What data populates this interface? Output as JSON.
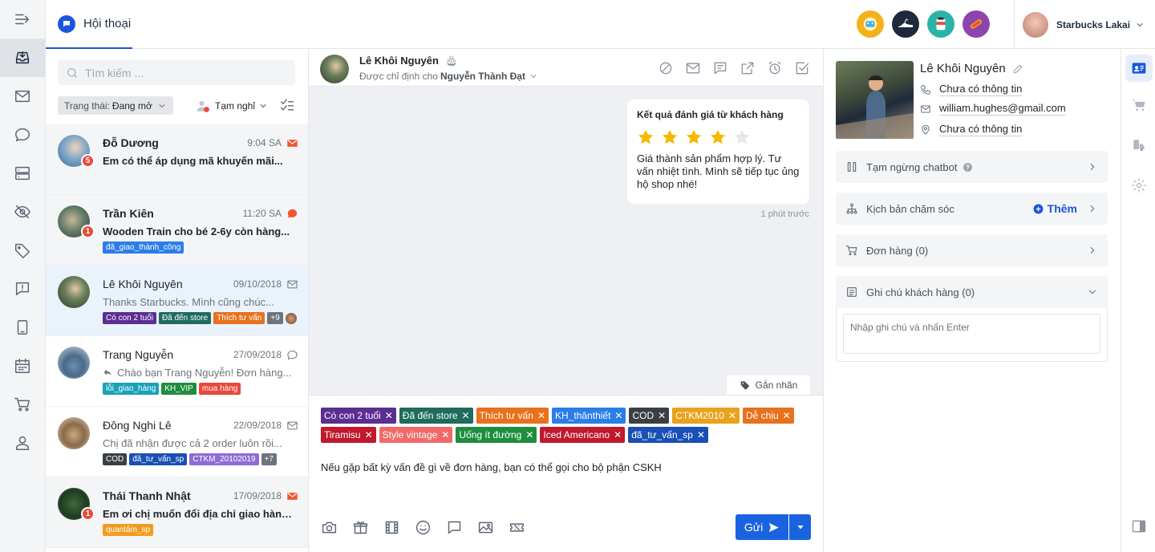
{
  "header": {
    "tab_title": "Hội thoại",
    "account_name": "Starbucks Lakai",
    "pages": [
      {
        "icon": "page-avatar-1",
        "color": "#f3b21a"
      },
      {
        "icon": "page-avatar-2",
        "color": "#1e2a3a"
      },
      {
        "icon": "page-avatar-3",
        "color": "#2bb3a8"
      },
      {
        "icon": "page-avatar-4",
        "color": "#8e44ad"
      }
    ]
  },
  "list": {
    "search_placeholder": "Tìm kiếm ...",
    "status_label": "Trạng thái:",
    "status_value": "Đang mở",
    "away_label": "Tạm nghỉ",
    "conversations": [
      {
        "name": "Đỗ Dương",
        "time": "9:04 SA",
        "message": "Em có thể áp dụng mã khuyến mãi...",
        "unread": 5,
        "channel": "email",
        "tags": []
      },
      {
        "name": "Trần Kiên",
        "time": "11:20 SA",
        "message": "Wooden Train cho bé 2-6y còn hàng...",
        "unread": 1,
        "channel": "chat",
        "tags": [
          {
            "label": "đã_giao_thành_công",
            "color": "#2b7de9"
          }
        ]
      },
      {
        "name": "Lê Khôi Nguyên",
        "time": "09/10/2018",
        "message": "Thanks Starbucks. Mình cũng chúc...",
        "unread": 0,
        "channel": "email",
        "tags": [
          {
            "label": "Có con 2 tuổi",
            "color": "#5b2e91"
          },
          {
            "label": "Đã đến store",
            "color": "#1f6b5e"
          },
          {
            "label": "Thích tư vấn",
            "color": "#e8711c"
          }
        ],
        "more": "+9"
      },
      {
        "name": "Trang Nguyễn",
        "time": "27/09/2018",
        "message": "Chào bạn Trang Nguyễn! Đơn hàng...",
        "unread": 0,
        "channel": "chat",
        "tags": [
          {
            "label": "lỗi_giao_hàng",
            "color": "#17a2b8"
          },
          {
            "label": "KH_VIP",
            "color": "#1e8e3e"
          },
          {
            "label": "mua hàng",
            "color": "#e8493a"
          }
        ]
      },
      {
        "name": "Đông Nghi Lê",
        "time": "22/09/2018",
        "message": "Chị đã nhận được cả 2 order luôn rồi...",
        "unread": 0,
        "channel": "email",
        "tags": [
          {
            "label": "COD",
            "color": "#3a3f44"
          },
          {
            "label": "đã_tư_vấn_sp",
            "color": "#1a4fb5"
          },
          {
            "label": "CTKM_20102019",
            "color": "#8e6bd6"
          }
        ],
        "more": "+7"
      },
      {
        "name": "Thái Thanh Nhật",
        "time": "17/09/2018",
        "message": "Em ơi chị muốn đổi địa chỉ giao hàng...",
        "unread": 1,
        "channel": "email",
        "tags": [
          {
            "label": "quantâm_sp",
            "color": "#f29c1f"
          }
        ]
      }
    ]
  },
  "chat": {
    "name": "Lê Khôi Nguyên",
    "assigned_label": "Được chỉ định cho",
    "assigned_to": "Nguyễn Thành Đạt",
    "bubble_title": "Kết quả đánh giá từ khách hàng",
    "rating": 4,
    "rating_max": 5,
    "bubble_text": "Giá thành sản phẩm hợp lý. Tư vấn nhiệt tình. Mình sẽ tiếp tục ủng hộ shop nhé!",
    "bubble_time": "1 phút trước",
    "tag_button": "Gắn nhãn",
    "composer_tags": [
      {
        "label": "Có con 2 tuổi",
        "color": "#5b2e91"
      },
      {
        "label": "Đã đến store",
        "color": "#1f6b5e"
      },
      {
        "label": "Thích tư vấn",
        "color": "#e8711c"
      },
      {
        "label": "KH_thânthiết",
        "color": "#2b7de9"
      },
      {
        "label": "COD",
        "color": "#3a3f44"
      },
      {
        "label": "CTKM2010",
        "color": "#e8a21c"
      },
      {
        "label": "Dễ chịu",
        "color": "#e8711c"
      },
      {
        "label": "Tiramisu",
        "color": "#c0182c"
      },
      {
        "label": "Style vintage",
        "color": "#f06a6a"
      },
      {
        "label": "Uống ít đường",
        "color": "#1e8e3e"
      },
      {
        "label": "Iced Americano",
        "color": "#c0182c"
      },
      {
        "label": "đã_tư_vấn_sp",
        "color": "#1a4fb5"
      }
    ],
    "composer_text": "Nếu gặp bất kỳ vấn đề gì về đơn hàng, bạn có thể gọi cho bộ phận CSKH",
    "send_label": "Gửi"
  },
  "customer": {
    "name": "Lê Khôi Nguyên",
    "phone": "Chưa có thông tin",
    "email": "william.hughes@gmail.com",
    "address": "Chưa có thông tin",
    "chatbot_label": "Tạm ngừng chatbot",
    "care_label": "Kịch bản chăm sóc",
    "care_add": "Thêm",
    "orders_label": "Đơn hàng (0)",
    "notes_label": "Ghi chú khách hàng (0)",
    "notes_placeholder": "Nhập ghi chú và nhấn Enter"
  }
}
